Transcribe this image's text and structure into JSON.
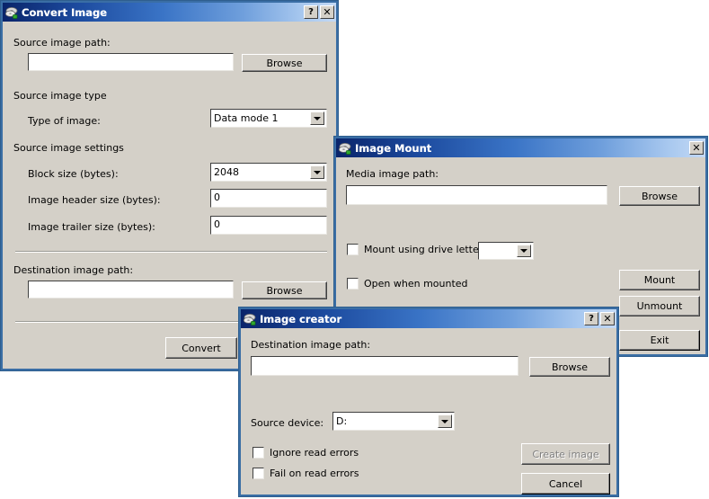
{
  "windows": {
    "convert": {
      "title": "Convert Image",
      "icon": "disc-drive-icon",
      "help_button": "?",
      "close_button": "✕",
      "source_path_label": "Source image path:",
      "source_path_value": "",
      "source_browse_label": "Browse",
      "source_type_group": "Source image type",
      "type_of_image_label": "Type of image:",
      "type_of_image_value": "Data mode 1",
      "type_of_image_options": [
        "Data mode 1"
      ],
      "settings_group": "Source image settings",
      "block_size_label": "Block size (bytes):",
      "block_size_value": "2048",
      "block_size_options": [
        "2048"
      ],
      "header_size_label": "Image header size (bytes):",
      "header_size_value": "0",
      "trailer_size_label": "Image trailer size (bytes):",
      "trailer_size_value": "0",
      "dest_path_label": "Destination image path:",
      "dest_path_value": "",
      "dest_browse_label": "Browse",
      "convert_label": "Convert"
    },
    "mount": {
      "title": "Image Mount",
      "icon": "disc-drive-icon",
      "close_button": "✕",
      "media_path_label": "Media image path:",
      "media_path_value": "",
      "browse_label": "Browse",
      "mount_drive_letter_label": "Mount using drive letter",
      "mount_drive_letter_checked": false,
      "drive_letter_value": "",
      "drive_letter_options": [],
      "open_when_mounted_label": "Open when mounted",
      "open_when_mounted_checked": false,
      "mount_label": "Mount",
      "unmount_label": "Unmount",
      "exit_label": "Exit"
    },
    "creator": {
      "title": "Image creator",
      "icon": "disc-drive-icon",
      "help_button": "?",
      "close_button": "✕",
      "dest_path_label": "Destination image path:",
      "dest_path_value": "",
      "browse_label": "Browse",
      "source_device_label": "Source device:",
      "source_device_value": "D:",
      "source_device_options": [
        "D:"
      ],
      "ignore_read_errors_label": "Ignore read errors",
      "ignore_read_errors_checked": false,
      "fail_on_read_errors_label": "Fail on read errors",
      "fail_on_read_errors_checked": false,
      "create_image_label": "Create image",
      "create_image_disabled": true,
      "cancel_label": "Cancel"
    }
  },
  "colors": {
    "title_active_start": "#0a246a",
    "title_active_end": "#c3d9f5",
    "window_face": "#d4d0c8",
    "window_border": "#3a6ea5",
    "field_bg": "#ffffff",
    "disabled_text": "#808080"
  }
}
